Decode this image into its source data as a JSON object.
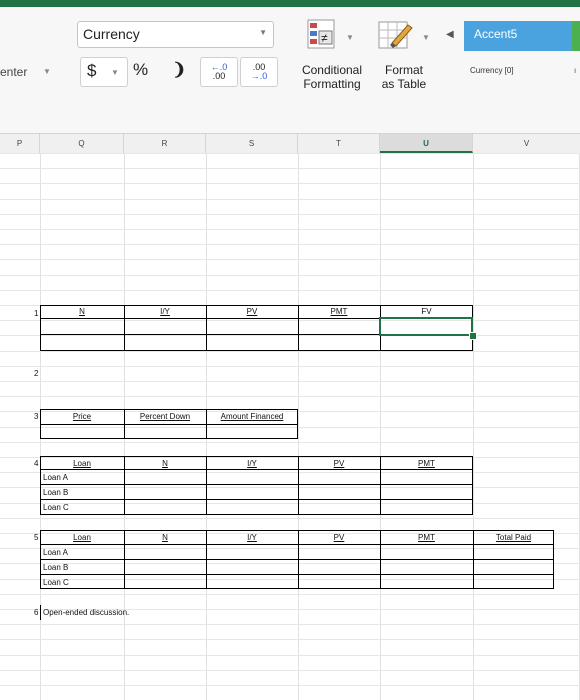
{
  "ribbon": {
    "number_format": "Currency",
    "alignment_label": "enter",
    "currency_symbol": "$",
    "percent_symbol": "%",
    "comma_symbol": "❩",
    "increase_decimal_top": "←.0",
    "increase_decimal_bottom": ".00",
    "decrease_decimal_top": ".00",
    "decrease_decimal_bottom": "→.0",
    "conditional_formatting": [
      "Conditional",
      "Formatting"
    ],
    "format_as_table": [
      "Format",
      "as Table"
    ],
    "style_accent": "Accent5",
    "style_currency": "Currency [0]"
  },
  "columns": [
    "P",
    "Q",
    "R",
    "S",
    "T",
    "U",
    "V"
  ],
  "selected_column": "U",
  "sheet": {
    "q1": {
      "num": "1",
      "headers": [
        "N",
        "I/Y",
        "PV",
        "PMT",
        "FV"
      ]
    },
    "q2": {
      "num": "2"
    },
    "q3": {
      "num": "3",
      "headers": [
        "Price",
        "Percent Down",
        "Amount Financed"
      ]
    },
    "q4": {
      "num": "4",
      "headers": [
        "Loan",
        "N",
        "I/Y",
        "PV",
        "PMT"
      ],
      "rows": [
        "Loan A",
        "Loan B",
        "Loan C"
      ]
    },
    "q5": {
      "num": "5",
      "headers": [
        "Loan",
        "N",
        "I/Y",
        "PV",
        "PMT",
        "Total Paid"
      ],
      "rows": [
        "Loan A",
        "Loan B",
        "Loan C"
      ]
    },
    "q6": {
      "num": "6",
      "text": "Open-ended discussion."
    }
  },
  "colors": {
    "excel_green": "#217346",
    "accent5": "#4aa3df"
  }
}
